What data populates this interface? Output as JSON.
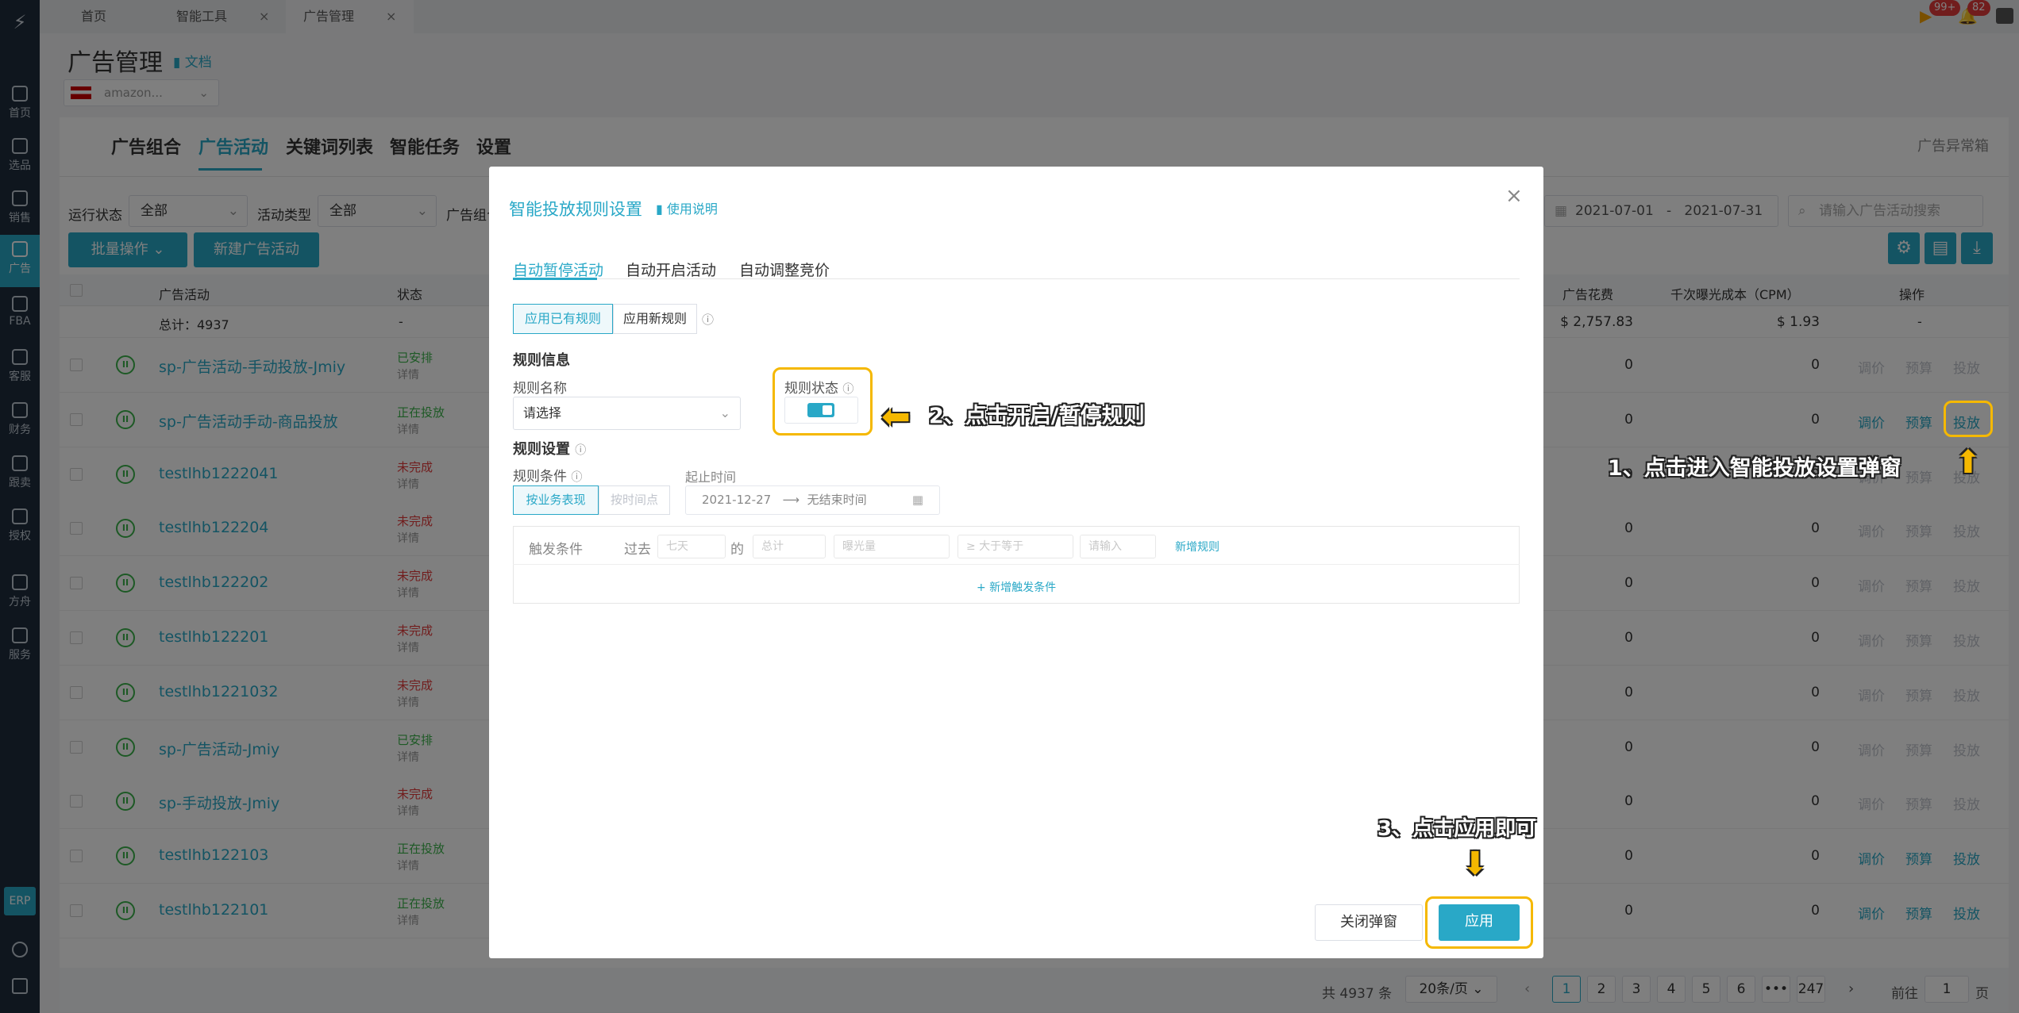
{
  "sidebar": {
    "items": [
      {
        "label": "首页",
        "icon": "home-icon"
      },
      {
        "label": "选品",
        "icon": "search-icon"
      },
      {
        "label": "销售",
        "icon": "chart-icon"
      },
      {
        "label": "广告",
        "icon": "ad-icon"
      },
      {
        "label": "FBA",
        "icon": "warehouse-icon"
      },
      {
        "label": "客服",
        "icon": "chat-icon"
      },
      {
        "label": "财务",
        "icon": "dollar-icon"
      },
      {
        "label": "跟卖",
        "icon": "pie-icon"
      },
      {
        "label": "授权",
        "icon": "shield-icon"
      },
      {
        "label": "方舟",
        "icon": "ship-icon"
      },
      {
        "label": "服务",
        "icon": "building-icon"
      }
    ],
    "erp_label": "ERP"
  },
  "topbar": {
    "tabs": [
      {
        "label": "首页"
      },
      {
        "label": "智能工具"
      },
      {
        "label": "广告管理"
      }
    ],
    "badge_1": "99+",
    "badge_2": "82"
  },
  "header": {
    "title": "广告管理",
    "doc_link": "文档",
    "shop": "amazon..."
  },
  "nav": {
    "tabs": [
      "广告组合",
      "广告活动",
      "关键词列表",
      "智能任务",
      "设置"
    ],
    "anomaly": "广告异常箱"
  },
  "filters": {
    "run_status_label": "运行状态",
    "run_status_value": "全部",
    "type_label": "活动类型",
    "type_value": "全部",
    "group_label": "广告组合",
    "date_start": "2021-07-01",
    "date_sep": "-",
    "date_end": "2021-07-31",
    "search_placeholder": "请输入广告活动搜索",
    "batch_label": "批量操作",
    "new_label": "新建广告活动"
  },
  "table": {
    "headers": {
      "name": "广告活动",
      "status": "状态",
      "spend": "广告花费",
      "cpm": "千次曝光成本（CPM）",
      "ops": "操作"
    },
    "total": {
      "name": "总计：4937",
      "status": "-",
      "spend": "$ 2,757.83",
      "cpm": "$ 1.93",
      "ops": "-"
    },
    "ops_labels": [
      "调价",
      "预算",
      "投放"
    ],
    "detail_label": "详情",
    "rows": [
      {
        "name": "sp-广告活动-手动投放-Jmiy",
        "status": "已安排",
        "status_color": "#3bb34a",
        "spend": "0",
        "cpm": "0",
        "ops_active": false
      },
      {
        "name": "sp-广告活动手动-商品投放",
        "status": "正在投放",
        "status_color": "#3bb34a",
        "spend": "0",
        "cpm": "0",
        "ops_active": true
      },
      {
        "name": "testlhb1222041",
        "status": "未完成",
        "status_color": "#e23a3a",
        "spend": "0",
        "cpm": "0",
        "ops_active": false
      },
      {
        "name": "testlhb122204",
        "status": "未完成",
        "status_color": "#e23a3a",
        "spend": "0",
        "cpm": "0",
        "ops_active": false
      },
      {
        "name": "testlhb122202",
        "status": "未完成",
        "status_color": "#e23a3a",
        "spend": "0",
        "cpm": "0",
        "ops_active": false
      },
      {
        "name": "testlhb122201",
        "status": "未完成",
        "status_color": "#e23a3a",
        "spend": "0",
        "cpm": "0",
        "ops_active": false
      },
      {
        "name": "testlhb1221032",
        "status": "未完成",
        "status_color": "#e23a3a",
        "spend": "0",
        "cpm": "0",
        "ops_active": false
      },
      {
        "name": "sp-广告活动-Jmiy",
        "status": "已安排",
        "status_color": "#3bb34a",
        "spend": "0",
        "cpm": "0",
        "ops_active": false
      },
      {
        "name": "sp-手动投放-Jmiy",
        "status": "未完成",
        "status_color": "#e23a3a",
        "spend": "0",
        "cpm": "0",
        "ops_active": false
      },
      {
        "name": "testlhb122103",
        "status": "正在投放",
        "status_color": "#3bb34a",
        "spend": "0",
        "cpm": "0",
        "ops_active": true
      },
      {
        "name": "testlhb122101",
        "status": "正在投放",
        "status_color": "#3bb34a",
        "spend": "0",
        "cpm": "0",
        "ops_active": true
      }
    ]
  },
  "pager": {
    "total": "共 4937 条",
    "page_size": "20条/页",
    "pages": [
      "1",
      "2",
      "3",
      "4",
      "5",
      "6",
      "•••",
      "247"
    ],
    "goto_label": "前往",
    "goto_value": "1",
    "page_unit": "页"
  },
  "modal": {
    "title": "智能投放规则设置",
    "doc": "使用说明",
    "tabs": [
      "自动暂停活动",
      "自动开启活动",
      "自动调整竞价"
    ],
    "apply_existing": "应用已有规则",
    "apply_new": "应用新规则",
    "rule_info": "规则信息",
    "rule_name_label": "规则名称",
    "rule_name_placeholder": "请选择",
    "rule_status_label": "规则状态",
    "rule_settings": "规则设置",
    "rule_condition_label": "规则条件",
    "by_business": "按业务表现",
    "by_time": "按时间点",
    "period_label": "起止时间",
    "date_start": "2021-12-27",
    "date_end": "无结束时间",
    "trigger_label": "触发条件",
    "past_label": "过去",
    "days": "七天",
    "of": "的",
    "agg": "总计",
    "metric": "曝光量",
    "op": "≥ 大于等于",
    "value_placeholder": "请输入",
    "add_rule": "新增规则",
    "add_condition": "+ 新增触发条件",
    "close_btn": "关闭弹窗",
    "apply_btn": "应用"
  },
  "callouts": {
    "c1": "1、点击进入智能投放设置弹窗",
    "c2": "2、点击开启/暂停规则",
    "c3": "3、点击应用即可"
  },
  "colors": {
    "accent": "#29a8c7",
    "highlight": "#f5b800",
    "sidebar": "#1f2d3d"
  }
}
